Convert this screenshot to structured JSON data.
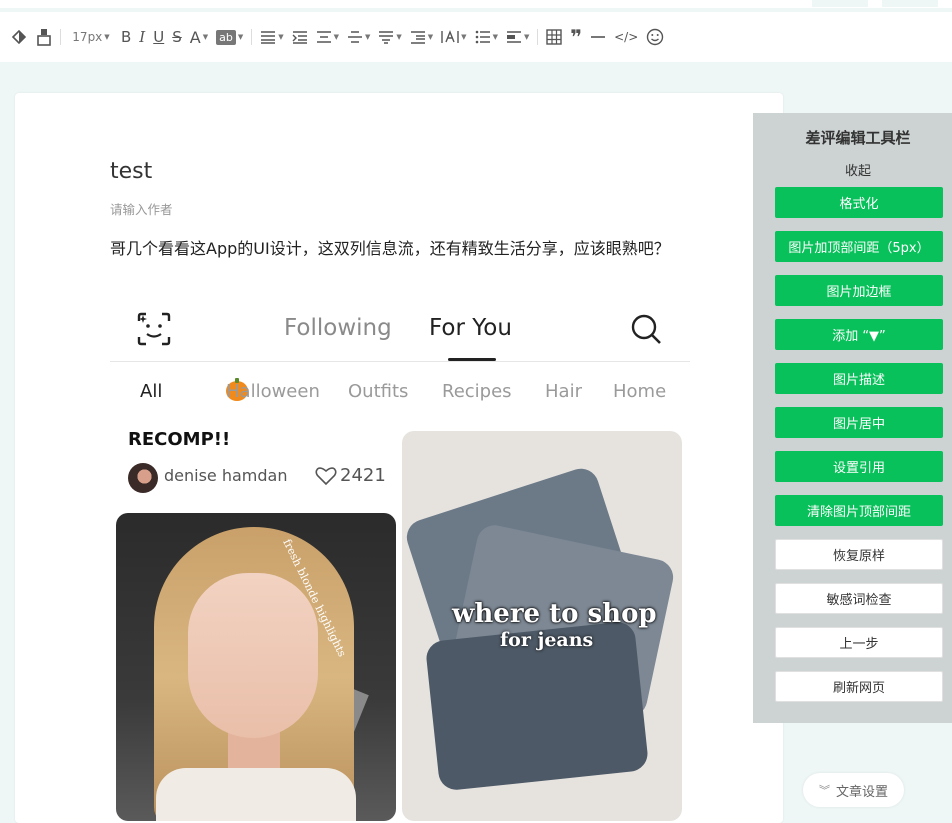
{
  "toolbar": {
    "font_size": "17px",
    "items": [
      "paint-format",
      "clear-format",
      "font-size",
      "bold",
      "italic",
      "underline",
      "strikethrough",
      "font-color",
      "background-color",
      "align",
      "indent",
      "line-spacing",
      "paragraph-spacing",
      "letter-spacing",
      "text-indent",
      "vertical-text",
      "list",
      "block",
      "table",
      "quote",
      "divider",
      "code",
      "emoji"
    ]
  },
  "editor": {
    "title": "test",
    "author_placeholder": "请输入作者",
    "paragraph": "哥几个看看这App的UI设计，这双列信息流，还有精致生活分享，应该眼熟吧？"
  },
  "embedded": {
    "tabs": [
      "Following",
      "For You"
    ],
    "active_tab": "For You",
    "categories": [
      "All",
      "Halloween",
      "Outfits",
      "Recipes",
      "Hair",
      "Home"
    ],
    "active_category": "All",
    "post": {
      "title": "RECOMP!!",
      "user": "denise hamdan",
      "likes": "2421"
    },
    "left_caption": "fresh blonde highlights",
    "right_caption_line1": "where to shop",
    "right_caption_line2": "for jeans"
  },
  "sidebar": {
    "title": "差评编辑工具栏",
    "collapse": "收起",
    "green_buttons": [
      "格式化",
      "图片加顶部间距（5px）",
      "图片加边框",
      "添加 “▼”",
      "图片描述",
      "图片居中",
      "设置引用",
      "清除图片顶部间距"
    ],
    "white_buttons": [
      "恢复原样",
      "敏感词检查",
      "上一步",
      "刷新网页"
    ],
    "colors": {
      "accent": "#08c15a",
      "panel": "#cdd3d3"
    }
  },
  "footer": {
    "article_settings": "文章设置"
  }
}
